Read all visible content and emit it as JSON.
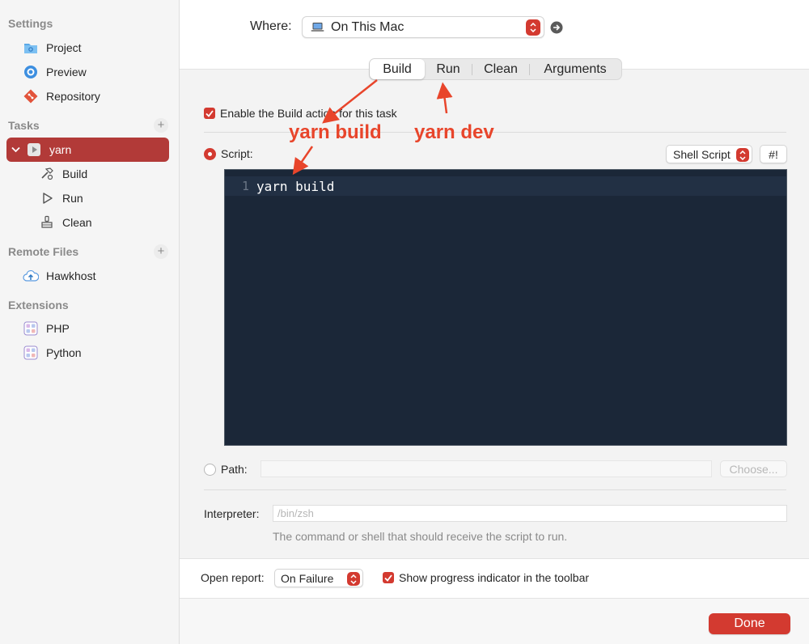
{
  "sidebar": {
    "settings_header": "Settings",
    "settings_items": [
      {
        "label": "Project",
        "icon": "folder-icon"
      },
      {
        "label": "Preview",
        "icon": "eye-icon"
      },
      {
        "label": "Repository",
        "icon": "git-icon"
      }
    ],
    "tasks_header": "Tasks",
    "tasks_add": "+",
    "task_selected": {
      "label": "yarn",
      "icon": "play-icon"
    },
    "task_children": [
      {
        "label": "Build",
        "icon": "hammer-icon"
      },
      {
        "label": "Run",
        "icon": "run-icon"
      },
      {
        "label": "Clean",
        "icon": "broom-icon"
      }
    ],
    "remote_header": "Remote Files",
    "remote_add": "+",
    "remote_items": [
      {
        "label": "Hawkhost",
        "icon": "cloud-upload-icon"
      }
    ],
    "extensions_header": "Extensions",
    "extension_items": [
      {
        "label": "PHP",
        "icon": "extension-icon"
      },
      {
        "label": "Python",
        "icon": "extension-icon"
      }
    ]
  },
  "where": {
    "label": "Where:",
    "value": "On This Mac"
  },
  "tabs": [
    {
      "label": "Build",
      "active": true
    },
    {
      "label": "Run",
      "active": false
    },
    {
      "label": "Clean",
      "active": false
    },
    {
      "label": "Arguments",
      "active": false
    }
  ],
  "build": {
    "enable_label": "Enable the Build action for this task",
    "enable_checked": true,
    "script_label": "Script:",
    "script_selected": true,
    "script_type": "Shell Script",
    "shebang_label": "#!",
    "editor": {
      "line_number": "1",
      "code": "yarn build"
    },
    "path_label": "Path:",
    "path_value": "",
    "choose_label": "Choose...",
    "interpreter_label": "Interpreter:",
    "interpreter_placeholder": "/bin/zsh",
    "interpreter_help": "The command or shell that should receive the script to run."
  },
  "bottom": {
    "open_report_label": "Open report:",
    "open_report_value": "On Failure",
    "progress_label": "Show progress indicator in the toolbar",
    "progress_checked": true
  },
  "footer": {
    "done_label": "Done"
  },
  "annotations": {
    "build_note": "yarn build",
    "run_note": "yarn dev"
  },
  "colors": {
    "accent": "#d33a30",
    "selection": "#b23a38",
    "annotation": "#e8452b",
    "editor_bg": "#1b2738"
  }
}
